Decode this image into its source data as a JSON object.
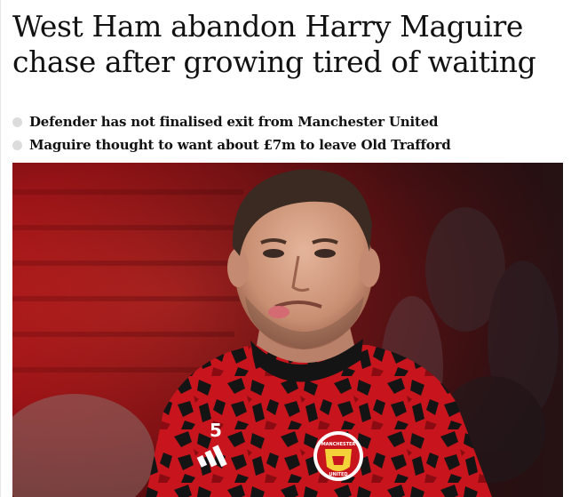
{
  "article": {
    "headline": "West Ham abandon Harry Maguire chase after growing tired of waiting",
    "bullets": [
      "Defender has not finalised exit from Manchester United",
      "Maguire thought to want about £7m to leave Old Trafford"
    ],
    "image": {
      "shirt_number": "5",
      "badge_text_top": "MANCHESTER",
      "badge_text_bottom": "UNITED"
    }
  },
  "colors": {
    "text": "#121212",
    "bullet": "#dcdcdc",
    "stadium_red": "#b3161a",
    "shirt_red": "#c8141c",
    "shirt_black": "#141414"
  }
}
